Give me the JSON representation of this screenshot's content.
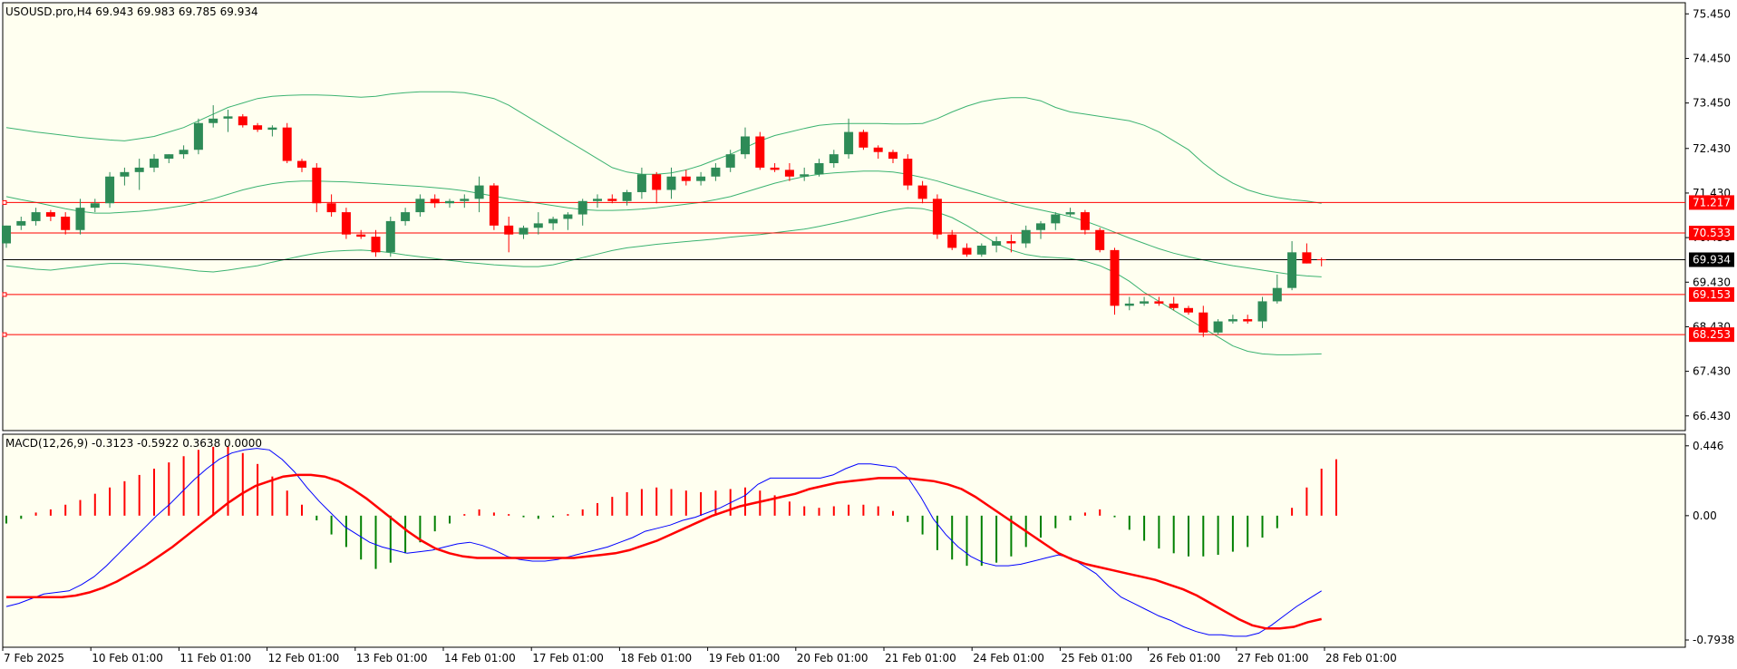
{
  "header": {
    "title": "USOUSD.pro,H4  69.943 69.983 69.785 69.934",
    "macd_title": "MACD(12,26,9) -0.3123 -0.5922 0.3638 0.0000"
  },
  "colors": {
    "background": "#fffff0",
    "bull": "#2e8b57",
    "bear": "#ff0000",
    "band": "#3cb371",
    "level": "#ff0000",
    "current": "#000000",
    "macd_line": "#0000ff",
    "signal_line": "#ff0000",
    "hist_pos": "#ff0000",
    "hist_neg": "#008000"
  },
  "chart_data": [
    {
      "type": "candlestick",
      "symbol": "USOUSD.pro",
      "timeframe": "H4",
      "ohlc_readout": {
        "open": 69.943,
        "high": 69.983,
        "low": 69.785,
        "close": 69.934
      },
      "ylim": [
        66.1,
        75.7
      ],
      "y_ticks": [
        "75.450",
        "74.450",
        "73.450",
        "72.430",
        "71.430",
        "70.430",
        "69.430",
        "68.430",
        "67.430",
        "66.430"
      ],
      "x_ticks": [
        "7 Feb 2025",
        "10 Feb 01:00",
        "11 Feb 01:00",
        "12 Feb 01:00",
        "13 Feb 01:00",
        "14 Feb 01:00",
        "17 Feb 01:00",
        "18 Feb 01:00",
        "19 Feb 01:00",
        "20 Feb 01:00",
        "21 Feb 01:00",
        "24 Feb 01:00",
        "25 Feb 01:00",
        "26 Feb 01:00",
        "27 Feb 01:00",
        "28 Feb 01:00"
      ],
      "current_price": {
        "label": "69.934",
        "value": 69.934
      },
      "levels": [
        {
          "label": "71.217",
          "value": 71.217
        },
        {
          "label": "70.533",
          "value": 70.533
        },
        {
          "label": "69.153",
          "value": 69.153
        },
        {
          "label": "68.253",
          "value": 68.253
        }
      ],
      "candles": [
        [
          70.3,
          70.7,
          70.2,
          70.7
        ],
        [
          70.7,
          70.9,
          70.6,
          70.8
        ],
        [
          70.8,
          71.1,
          70.7,
          71.0
        ],
        [
          71.0,
          71.05,
          70.8,
          70.9
        ],
        [
          70.9,
          71.0,
          70.5,
          70.6
        ],
        [
          70.6,
          71.3,
          70.5,
          71.1
        ],
        [
          71.1,
          71.3,
          71.0,
          71.2
        ],
        [
          71.2,
          71.9,
          71.1,
          71.8
        ],
        [
          71.8,
          72.0,
          71.6,
          71.9
        ],
        [
          71.9,
          72.2,
          71.5,
          72.0
        ],
        [
          72.0,
          72.3,
          71.9,
          72.2
        ],
        [
          72.2,
          72.3,
          72.1,
          72.3
        ],
        [
          72.3,
          72.5,
          72.2,
          72.4
        ],
        [
          72.4,
          73.1,
          72.3,
          73.0
        ],
        [
          73.0,
          73.4,
          72.9,
          73.1
        ],
        [
          73.1,
          73.3,
          72.8,
          73.15
        ],
        [
          73.15,
          73.2,
          72.9,
          72.95
        ],
        [
          72.95,
          73.0,
          72.8,
          72.85
        ],
        [
          72.85,
          72.95,
          72.7,
          72.9
        ],
        [
          72.9,
          73.0,
          72.1,
          72.15
        ],
        [
          72.15,
          72.2,
          71.9,
          72.0
        ],
        [
          72.0,
          72.1,
          71.0,
          71.2
        ],
        [
          71.2,
          71.4,
          70.9,
          71.0
        ],
        [
          71.0,
          71.1,
          70.4,
          70.5
        ],
        [
          70.5,
          70.6,
          70.4,
          70.45
        ],
        [
          70.45,
          70.6,
          70.0,
          70.1
        ],
        [
          70.1,
          70.9,
          70.0,
          70.8
        ],
        [
          70.8,
          71.1,
          70.7,
          71.0
        ],
        [
          71.0,
          71.4,
          70.9,
          71.3
        ],
        [
          71.3,
          71.4,
          71.1,
          71.2
        ],
        [
          71.2,
          71.3,
          71.1,
          71.25
        ],
        [
          71.25,
          71.4,
          71.1,
          71.3
        ],
        [
          71.3,
          71.8,
          71.0,
          71.6
        ],
        [
          71.6,
          71.65,
          70.6,
          70.7
        ],
        [
          70.7,
          70.9,
          70.1,
          70.5
        ],
        [
          70.5,
          70.7,
          70.4,
          70.65
        ],
        [
          70.65,
          71.0,
          70.5,
          70.75
        ],
        [
          70.75,
          70.9,
          70.6,
          70.85
        ],
        [
          70.85,
          71.0,
          70.6,
          70.95
        ],
        [
          70.95,
          71.3,
          70.7,
          71.25
        ],
        [
          71.25,
          71.4,
          71.1,
          71.3
        ],
        [
          71.3,
          71.4,
          71.2,
          71.25
        ],
        [
          71.25,
          71.5,
          71.15,
          71.45
        ],
        [
          71.45,
          72.0,
          71.3,
          71.85
        ],
        [
          71.85,
          71.9,
          71.2,
          71.5
        ],
        [
          71.5,
          72.0,
          71.3,
          71.8
        ],
        [
          71.8,
          71.95,
          71.6,
          71.7
        ],
        [
          71.7,
          71.9,
          71.6,
          71.8
        ],
        [
          71.8,
          72.1,
          71.7,
          72.0
        ],
        [
          72.0,
          72.4,
          71.9,
          72.3
        ],
        [
          72.3,
          72.9,
          72.2,
          72.7
        ],
        [
          72.7,
          72.8,
          71.95,
          72.0
        ],
        [
          72.0,
          72.1,
          71.9,
          71.95
        ],
        [
          71.95,
          72.1,
          71.7,
          71.8
        ],
        [
          71.8,
          72.0,
          71.7,
          71.85
        ],
        [
          71.85,
          72.2,
          71.8,
          72.1
        ],
        [
          72.1,
          72.4,
          72.0,
          72.3
        ],
        [
          72.3,
          73.1,
          72.2,
          72.8
        ],
        [
          72.8,
          72.85,
          72.4,
          72.45
        ],
        [
          72.45,
          72.5,
          72.2,
          72.35
        ],
        [
          72.35,
          72.4,
          72.1,
          72.2
        ],
        [
          72.2,
          72.3,
          71.5,
          71.6
        ],
        [
          71.6,
          71.7,
          71.2,
          71.3
        ],
        [
          71.3,
          71.4,
          70.4,
          70.5
        ],
        [
          70.5,
          70.6,
          70.15,
          70.2
        ],
        [
          70.2,
          70.3,
          70.0,
          70.05
        ],
        [
          70.05,
          70.3,
          70.0,
          70.25
        ],
        [
          70.25,
          70.45,
          70.1,
          70.35
        ],
        [
          70.35,
          70.5,
          70.1,
          70.3
        ],
        [
          70.3,
          70.7,
          70.2,
          70.6
        ],
        [
          70.6,
          70.8,
          70.4,
          70.75
        ],
        [
          70.75,
          71.0,
          70.6,
          70.95
        ],
        [
          70.95,
          71.1,
          70.9,
          71.0
        ],
        [
          71.0,
          71.05,
          70.5,
          70.6
        ],
        [
          70.6,
          70.65,
          70.1,
          70.15
        ],
        [
          70.15,
          70.2,
          68.7,
          68.9
        ],
        [
          68.9,
          69.1,
          68.8,
          68.95
        ],
        [
          68.95,
          69.1,
          68.9,
          69.0
        ],
        [
          69.0,
          69.1,
          68.9,
          68.95
        ],
        [
          68.95,
          69.1,
          68.8,
          68.85
        ],
        [
          68.85,
          68.9,
          68.7,
          68.75
        ],
        [
          68.75,
          68.9,
          68.2,
          68.3
        ],
        [
          68.3,
          68.6,
          68.25,
          68.55
        ],
        [
          68.55,
          68.7,
          68.5,
          68.6
        ],
        [
          68.6,
          68.7,
          68.5,
          68.55
        ],
        [
          68.55,
          69.1,
          68.4,
          69.0
        ],
        [
          69.0,
          69.6,
          68.95,
          69.3
        ],
        [
          69.3,
          70.35,
          69.25,
          70.1
        ],
        [
          70.1,
          70.3,
          69.85,
          69.85
        ],
        [
          69.943,
          69.983,
          69.785,
          69.934
        ]
      ],
      "bollinger": {
        "upper": [
          72.9,
          72.85,
          72.8,
          72.76,
          72.72,
          72.68,
          72.65,
          72.62,
          72.6,
          72.65,
          72.7,
          72.8,
          72.9,
          73.05,
          73.2,
          73.35,
          73.45,
          73.55,
          73.6,
          73.62,
          73.63,
          73.63,
          73.62,
          73.6,
          73.58,
          73.6,
          73.65,
          73.68,
          73.7,
          73.7,
          73.7,
          73.68,
          73.62,
          73.55,
          73.4,
          73.2,
          73.0,
          72.8,
          72.6,
          72.4,
          72.2,
          72.0,
          71.9,
          71.85,
          71.85,
          71.88,
          71.95,
          72.05,
          72.18,
          72.3,
          72.45,
          72.6,
          72.72,
          72.8,
          72.88,
          72.95,
          72.98,
          72.99,
          72.99,
          72.99,
          72.98,
          72.98,
          72.99,
          73.1,
          73.25,
          73.38,
          73.48,
          73.54,
          73.57,
          73.57,
          73.5,
          73.35,
          73.25,
          73.2,
          73.15,
          73.1,
          73.05,
          72.95,
          72.8,
          72.6,
          72.4,
          72.1,
          71.85,
          71.65,
          71.5,
          71.4,
          71.33,
          71.28,
          71.25,
          71.2
        ],
        "middle": [
          71.35,
          71.28,
          71.22,
          71.15,
          71.08,
          71.02,
          70.98,
          70.98,
          71.0,
          71.02,
          71.05,
          71.1,
          71.15,
          71.22,
          71.3,
          71.4,
          71.5,
          71.58,
          71.64,
          71.68,
          71.7,
          71.7,
          71.69,
          71.68,
          71.66,
          71.64,
          71.62,
          71.6,
          71.58,
          71.55,
          71.52,
          71.48,
          71.42,
          71.36,
          71.3,
          71.25,
          71.2,
          71.15,
          71.1,
          71.06,
          71.04,
          71.04,
          71.05,
          71.07,
          71.1,
          71.14,
          71.18,
          71.22,
          71.28,
          71.35,
          71.45,
          71.55,
          71.65,
          71.73,
          71.8,
          71.85,
          71.88,
          71.9,
          71.92,
          71.92,
          71.9,
          71.85,
          71.78,
          71.7,
          71.6,
          71.5,
          71.4,
          71.3,
          71.2,
          71.12,
          71.05,
          70.98,
          70.9,
          70.8,
          70.68,
          70.55,
          70.42,
          70.3,
          70.18,
          70.08,
          70.0,
          69.93,
          69.86,
          69.8,
          69.75,
          69.7,
          69.65,
          69.6,
          69.57,
          69.55
        ],
        "lower": [
          69.8,
          69.76,
          69.72,
          69.7,
          69.74,
          69.78,
          69.82,
          69.85,
          69.85,
          69.83,
          69.8,
          69.76,
          69.72,
          69.68,
          69.66,
          69.7,
          69.75,
          69.8,
          69.88,
          69.95,
          70.02,
          70.08,
          70.12,
          70.14,
          70.15,
          70.13,
          70.09,
          70.04,
          70.0,
          69.96,
          69.92,
          69.88,
          69.85,
          69.82,
          69.8,
          69.78,
          69.78,
          69.82,
          69.9,
          69.98,
          70.06,
          70.14,
          70.2,
          70.24,
          70.28,
          70.31,
          70.34,
          70.37,
          70.4,
          70.44,
          70.47,
          70.5,
          70.54,
          70.58,
          70.62,
          70.68,
          70.75,
          70.82,
          70.9,
          70.98,
          71.05,
          71.1,
          71.08,
          71.0,
          70.88,
          70.7,
          70.5,
          70.3,
          70.15,
          70.05,
          70.0,
          69.98,
          69.96,
          69.9,
          69.8,
          69.65,
          69.45,
          69.2,
          69.0,
          68.8,
          68.6,
          68.4,
          68.2,
          68.0,
          67.88,
          67.82,
          67.8,
          67.8,
          67.81,
          67.82
        ]
      }
    },
    {
      "type": "macd",
      "title": "MACD(12,26,9) -0.3123 -0.5922 0.3638 0.0000",
      "params": [
        12,
        26,
        9
      ],
      "ylim": [
        -0.84,
        0.52
      ],
      "y_ticks": [
        "0.446",
        "0.00",
        "-0.7938"
      ],
      "histogram": [
        -0.05,
        -0.02,
        0.02,
        0.04,
        0.07,
        0.1,
        0.14,
        0.18,
        0.22,
        0.26,
        0.3,
        0.34,
        0.38,
        0.42,
        0.44,
        0.44,
        0.4,
        0.33,
        0.25,
        0.16,
        0.07,
        -0.03,
        -0.12,
        -0.2,
        -0.28,
        -0.34,
        -0.3,
        -0.24,
        -0.17,
        -0.1,
        -0.05,
        0.01,
        0.04,
        0.02,
        0.01,
        -0.01,
        -0.02,
        -0.01,
        0.01,
        0.04,
        0.08,
        0.12,
        0.15,
        0.17,
        0.18,
        0.17,
        0.16,
        0.15,
        0.16,
        0.17,
        0.18,
        0.16,
        0.13,
        0.09,
        0.06,
        0.05,
        0.06,
        0.07,
        0.07,
        0.06,
        0.03,
        -0.04,
        -0.12,
        -0.22,
        -0.28,
        -0.32,
        -0.32,
        -0.3,
        -0.26,
        -0.2,
        -0.14,
        -0.08,
        -0.03,
        0.02,
        0.04,
        -0.01,
        -0.09,
        -0.16,
        -0.21,
        -0.24,
        -0.26,
        -0.26,
        -0.25,
        -0.23,
        -0.2,
        -0.14,
        -0.08,
        0.05,
        0.18,
        0.3,
        0.36
      ],
      "macd_line": [
        -0.58,
        -0.56,
        -0.53,
        -0.5,
        -0.49,
        -0.48,
        -0.44,
        -0.39,
        -0.32,
        -0.24,
        -0.16,
        -0.08,
        0.0,
        0.07,
        0.15,
        0.23,
        0.3,
        0.36,
        0.4,
        0.42,
        0.43,
        0.42,
        0.36,
        0.28,
        0.18,
        0.09,
        0.01,
        -0.07,
        -0.12,
        -0.17,
        -0.2,
        -0.22,
        -0.24,
        -0.23,
        -0.22,
        -0.2,
        -0.18,
        -0.17,
        -0.19,
        -0.22,
        -0.26,
        -0.28,
        -0.29,
        -0.29,
        -0.28,
        -0.26,
        -0.24,
        -0.22,
        -0.2,
        -0.17,
        -0.14,
        -0.1,
        -0.08,
        -0.06,
        -0.03,
        -0.01,
        0.02,
        0.05,
        0.09,
        0.13,
        0.2,
        0.24,
        0.24,
        0.24,
        0.24,
        0.24,
        0.26,
        0.3,
        0.33,
        0.33,
        0.32,
        0.31,
        0.24,
        0.12,
        -0.02,
        -0.12,
        -0.2,
        -0.26,
        -0.3,
        -0.32,
        -0.32,
        -0.31,
        -0.29,
        -0.27,
        -0.25,
        -0.27,
        -0.32,
        -0.37,
        -0.45,
        -0.52,
        -0.56,
        -0.6,
        -0.64,
        -0.67,
        -0.71,
        -0.74,
        -0.76,
        -0.76,
        -0.77,
        -0.77,
        -0.75,
        -0.7,
        -0.64,
        -0.58,
        -0.53,
        -0.48
      ],
      "signal_line": [
        -0.52,
        -0.52,
        -0.52,
        -0.52,
        -0.52,
        -0.51,
        -0.49,
        -0.46,
        -0.42,
        -0.37,
        -0.32,
        -0.26,
        -0.2,
        -0.13,
        -0.06,
        0.01,
        0.08,
        0.14,
        0.19,
        0.22,
        0.25,
        0.26,
        0.26,
        0.25,
        0.22,
        0.17,
        0.11,
        0.04,
        -0.03,
        -0.1,
        -0.16,
        -0.21,
        -0.24,
        -0.26,
        -0.27,
        -0.27,
        -0.27,
        -0.27,
        -0.27,
        -0.27,
        -0.27,
        -0.27,
        -0.26,
        -0.25,
        -0.24,
        -0.22,
        -0.19,
        -0.16,
        -0.12,
        -0.08,
        -0.04,
        0.0,
        0.03,
        0.06,
        0.08,
        0.1,
        0.12,
        0.14,
        0.17,
        0.19,
        0.21,
        0.22,
        0.23,
        0.24,
        0.24,
        0.24,
        0.23,
        0.22,
        0.2,
        0.17,
        0.12,
        0.06,
        0.0,
        -0.06,
        -0.12,
        -0.18,
        -0.24,
        -0.28,
        -0.31,
        -0.33,
        -0.35,
        -0.37,
        -0.39,
        -0.41,
        -0.44,
        -0.47,
        -0.51,
        -0.56,
        -0.61,
        -0.66,
        -0.7,
        -0.72,
        -0.72,
        -0.71,
        -0.68,
        -0.66
      ]
    }
  ]
}
